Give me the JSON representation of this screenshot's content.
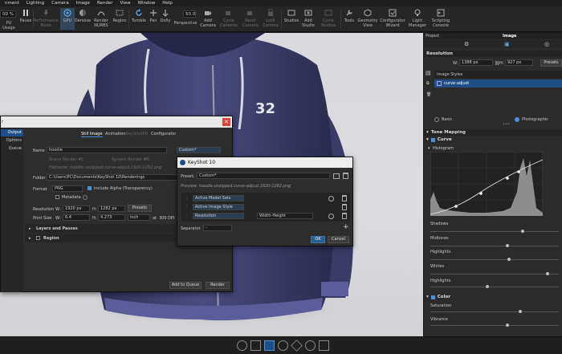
{
  "menubar": {
    "items": [
      "nment",
      "Lighting",
      "Camera",
      "Image",
      "Render",
      "View",
      "Window",
      "Help"
    ]
  },
  "toolbar": {
    "cpu_value": "00 %",
    "cpu_label": "PU Usage",
    "pause": "Pause",
    "performance_mode": "Performance Mode",
    "gpu": "GPU",
    "denoise": "Denoise",
    "render_nurbs": "Render NURBS",
    "region": "Region",
    "tumble": "Tumble",
    "pan": "Pan",
    "dolly": "Dolly",
    "perspective_value": "50.0",
    "perspective": "Perspective",
    "add_camera": "Add Camera",
    "cycle_cameras": "Cycle Cameras",
    "reset_camera": "Reset Camera",
    "lock_camera": "Lock Camera",
    "studios": "Studios",
    "add_studio": "Add Studio",
    "cycle_studios": "Cycle Studios",
    "tools": "Tools",
    "geometry_view": "Geometry View",
    "configurator_wizard": "Configurator Wizard",
    "light_manager": "Light Manager",
    "scripting_console": "Scripting Console"
  },
  "right_panel": {
    "tabs": {
      "project": "Project",
      "image": "Image"
    },
    "resolution_label": "Resolution",
    "w_label": "W:",
    "w_value": "1388 px",
    "h_label": "H:",
    "h_value": "927 px",
    "presets": "Presets",
    "image_styles": "Image Styles",
    "style_item": "curve-adjust",
    "mode_basic": "Basic",
    "mode_photographic": "Photographic",
    "tone_mapping": "Tone Mapping",
    "curve": "Curve",
    "histogram": "Histogram",
    "sliders": [
      "Shadows",
      "Midtones",
      "Highlights",
      "Whites",
      "Highlights"
    ],
    "color": "Color",
    "saturation": "Saturation",
    "vibrance": "Vibrance"
  },
  "render_dialog": {
    "title": "r",
    "side_nav": [
      "Output",
      "Options",
      "Queue"
    ],
    "tabs": [
      "Still Image",
      "Animation",
      "KeyShotXR",
      "Configurator"
    ],
    "name_label": "Name",
    "name_value": "hoodie",
    "preset_value": "Custom*",
    "scene_render": "Scene Render #",
    "scene_render_value": "1",
    "system_render": "System Render #",
    "system_render_value": "5",
    "filename": "Filename: hoodie.unzipped.curve-adjust.1920-1282.png",
    "folder_label": "Folder",
    "folder_value": "C:\\Users\\PC\\Documents\\KeyShot 10\\Renderings",
    "format_label": "Format",
    "format_value": "PNG",
    "include_alpha": "Include Alpha (Transparency)",
    "metadata": "Metadata",
    "resolution_label": "Resolution",
    "w_label": "W:",
    "w_value": "1920 px",
    "h_label": "H:",
    "h_value": "1282 px",
    "presets": "Presets",
    "print_size_label": "Print Size",
    "print_w": "6.4",
    "print_h": "4.273",
    "print_unit": "inch",
    "dpi_at": "at",
    "dpi_value": "300",
    "dpi_label": "DPI",
    "layers_and_passes": "Layers and Passes",
    "region": "Region",
    "add_to_queue": "Add to Queue",
    "render": "Render"
  },
  "keyshot_dialog": {
    "title": "KeyShot 10",
    "preset_label": "Preset:",
    "preset_value": "Custom*",
    "preview": "Preview: hoodie.unzipped.curve-adjust.1920-1282.png",
    "rows": [
      {
        "name": "Active Model Sets",
        "value": ""
      },
      {
        "name": "Active Image Style",
        "value": ""
      },
      {
        "name": "Resolution",
        "value": "Width-Height"
      }
    ],
    "separator_label": "Separator",
    "separator_value": "-",
    "ok": "OK",
    "cancel": "Cancel"
  },
  "hoodie": {
    "number": "32"
  },
  "colors": {
    "accent": "#4a90d9",
    "selection": "#1f4f86",
    "hoodie": "#3e3f6e"
  }
}
